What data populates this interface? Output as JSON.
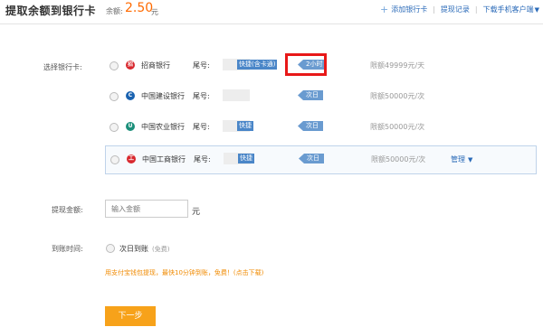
{
  "header": {
    "title": "提取余额到银行卡",
    "balance_label": "余额:",
    "balance_amount": "2.50",
    "balance_unit": "元",
    "links": {
      "add_card": "添加银行卡",
      "history": "提现记录",
      "mobile_app": "下载手机客户端"
    }
  },
  "form": {
    "card_label": "选择银行卡:",
    "tail_label": "尾号:",
    "banks": [
      {
        "name": "招商银行",
        "tag": "快捷(含卡通)",
        "arrival": "2小时",
        "limit": "限额49999元/天",
        "logo_char": "招",
        "logo_color": "#d8282e"
      },
      {
        "name": "中国建设银行",
        "tag": "",
        "arrival": "次日",
        "limit": "限额50000元/次",
        "logo_char": "C",
        "logo_color": "#1a62b0"
      },
      {
        "name": "中国农业银行",
        "tag": "快捷",
        "arrival": "次日",
        "limit": "限额50000元/次",
        "logo_char": "U",
        "logo_color": "#1b8f7a"
      },
      {
        "name": "中国工商银行",
        "tag": "快捷",
        "arrival": "次日",
        "limit": "限额50000元/次",
        "logo_char": "工",
        "logo_color": "#d8282e",
        "manage": "管理"
      }
    ],
    "amount_label": "提现金额:",
    "amount_placeholder": "输入金额",
    "amount_unit": "元",
    "arrival_label": "到账时间:",
    "arrival_option": "次日到账",
    "arrival_note": "(免费)",
    "promo_text": "用支付宝钱包提现，最快10分钟到账，免费！(点击下载)",
    "next_button": "下一步"
  },
  "colors": {
    "accent_orange": "#f7a21a",
    "link_blue": "#2a6ab8",
    "balance_orange": "#ff6a00",
    "highlight_red": "#e81818"
  }
}
